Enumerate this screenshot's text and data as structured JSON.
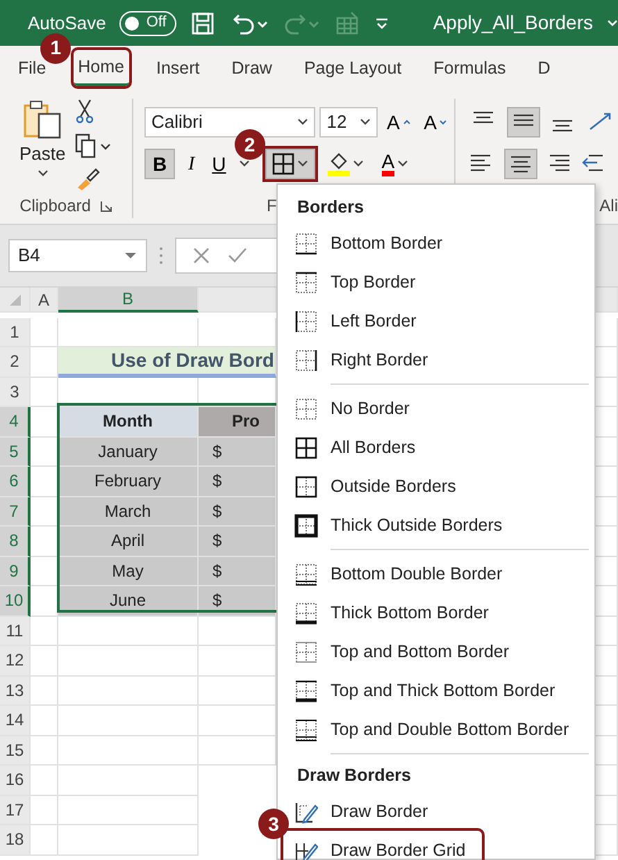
{
  "title_bar": {
    "autosave_label": "AutoSave",
    "autosave_on": false,
    "autosave_state": "Off",
    "file_name": "Apply_All_Borders"
  },
  "tabs": [
    {
      "label": "File",
      "selected": false
    },
    {
      "label": "Home",
      "selected": true,
      "callout": "1"
    },
    {
      "label": "Insert",
      "selected": false
    },
    {
      "label": "Draw",
      "selected": false
    },
    {
      "label": "Page Layout",
      "selected": false
    },
    {
      "label": "Formulas",
      "selected": false
    },
    {
      "label": "D",
      "selected": false
    }
  ],
  "ribbon": {
    "clipboard": {
      "paste_label": "Paste",
      "group_label": "Clipboard"
    },
    "font": {
      "font_name": "Calibri",
      "font_size": "12",
      "grow_label": "A",
      "shrink_label": "A",
      "bold": "B",
      "italic": "I",
      "underline": "U",
      "bold_on": true,
      "border_callout": "2",
      "font_color_label": "A",
      "group_label": "F"
    },
    "alignment": {
      "group_label": "Ali"
    }
  },
  "formula_bar": {
    "name_box": "B4"
  },
  "sheet": {
    "columns": [
      {
        "label": "A",
        "selected": false
      },
      {
        "label": "B",
        "selected": true
      }
    ],
    "rows": [
      {
        "label": "1",
        "selected": false
      },
      {
        "label": "2",
        "selected": false
      },
      {
        "label": "3",
        "selected": false
      },
      {
        "label": "4",
        "selected": true
      },
      {
        "label": "5",
        "selected": true
      },
      {
        "label": "6",
        "selected": true
      },
      {
        "label": "7",
        "selected": true
      },
      {
        "label": "8",
        "selected": true
      },
      {
        "label": "9",
        "selected": true
      },
      {
        "label": "10",
        "selected": true
      },
      {
        "label": "11",
        "selected": false
      },
      {
        "label": "12",
        "selected": false
      },
      {
        "label": "13",
        "selected": false
      },
      {
        "label": "14",
        "selected": false
      },
      {
        "label": "15",
        "selected": false
      },
      {
        "label": "16",
        "selected": false
      },
      {
        "label": "17",
        "selected": false
      },
      {
        "label": "18",
        "selected": false
      }
    ],
    "title": "Use of Draw Bord",
    "table": {
      "columns": [
        "Month",
        "Pro"
      ],
      "rows": [
        [
          "January",
          "$"
        ],
        [
          "February",
          "$"
        ],
        [
          "March",
          "$"
        ],
        [
          "April",
          "$"
        ],
        [
          "May",
          "$"
        ],
        [
          "June",
          "$"
        ]
      ]
    }
  },
  "menu": {
    "sections": [
      {
        "title": "Borders",
        "groups": [
          [
            {
              "label": "Bottom Border",
              "kind": "bottom"
            },
            {
              "label": "Top Border",
              "kind": "top"
            },
            {
              "label": "Left Border",
              "kind": "left"
            },
            {
              "label": "Right Border",
              "kind": "right"
            }
          ],
          [
            {
              "label": "No Border",
              "kind": "none"
            },
            {
              "label": "All Borders",
              "kind": "all"
            },
            {
              "label": "Outside Borders",
              "kind": "outside"
            },
            {
              "label": "Thick Outside Borders",
              "kind": "thick-outside"
            }
          ],
          [
            {
              "label": "Bottom Double Border",
              "kind": "bottom-double"
            },
            {
              "label": "Thick Bottom Border",
              "kind": "thick-bottom"
            },
            {
              "label": "Top and Bottom Border",
              "kind": "top-bottom"
            },
            {
              "label": "Top and Thick Bottom Border",
              "kind": "top-thick-bottom"
            },
            {
              "label": "Top and Double Bottom Border",
              "kind": "top-double-bottom"
            }
          ]
        ]
      },
      {
        "title": "Draw Borders",
        "groups": [
          [
            {
              "label": "Draw Border",
              "kind": "draw"
            },
            {
              "label": "Draw Border Grid",
              "kind": "draw-grid",
              "callout": "3"
            }
          ]
        ]
      }
    ]
  }
}
